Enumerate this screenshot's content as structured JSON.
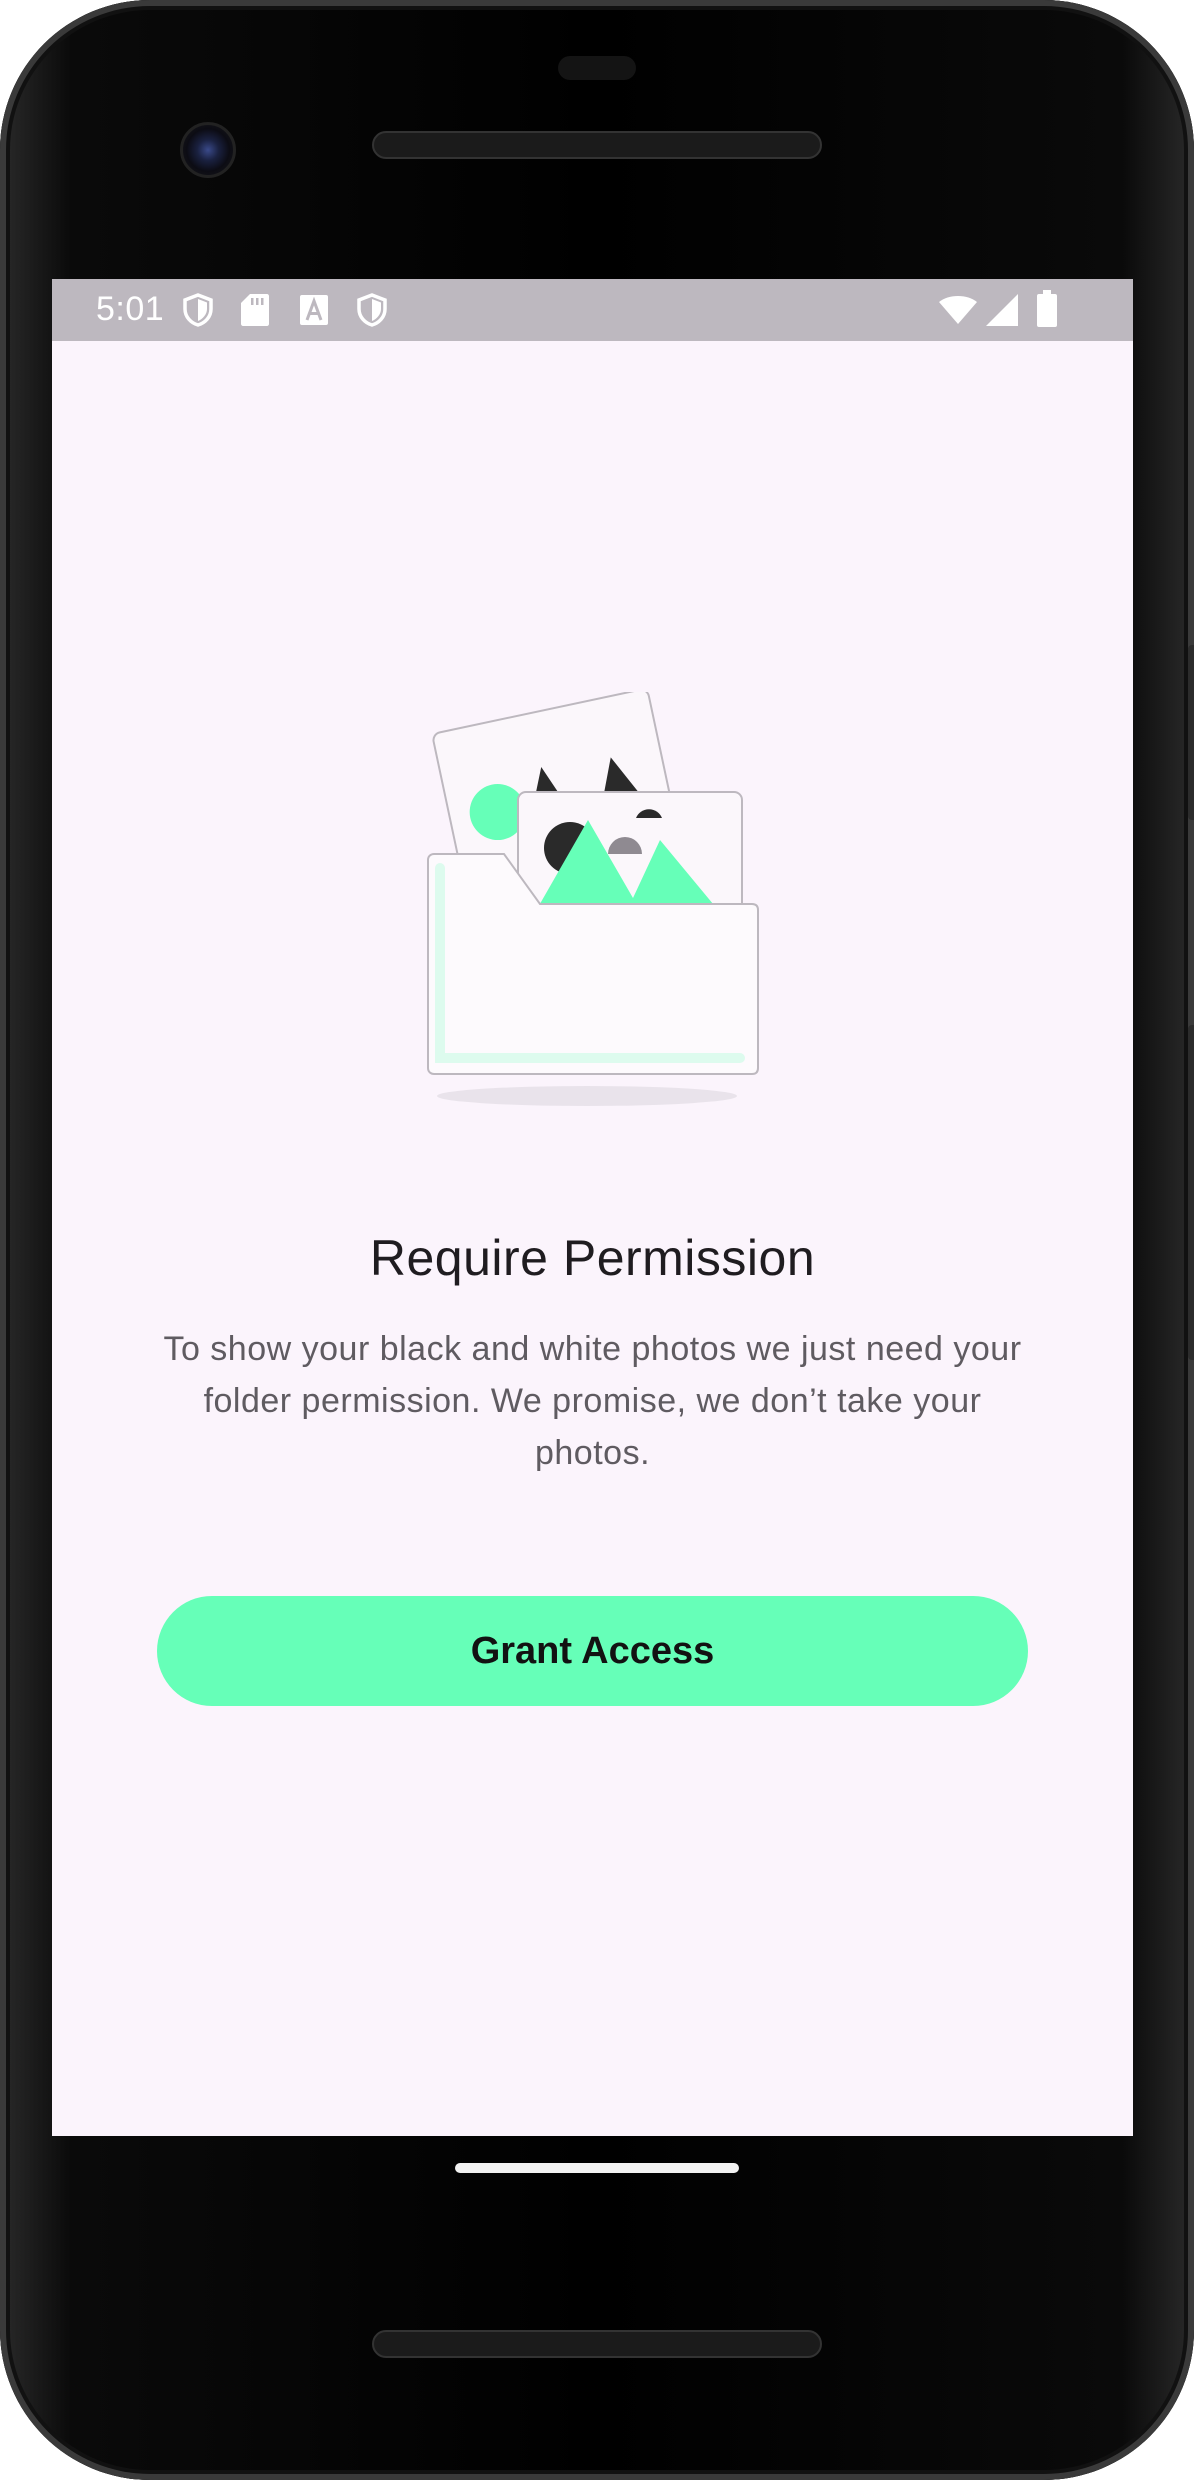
{
  "status_bar": {
    "time": "5:01",
    "left_icons": [
      "shield-icon",
      "sd-card-icon",
      "font-a-icon",
      "shield-icon"
    ],
    "right_icons": [
      "wifi-icon",
      "signal-icon",
      "battery-icon"
    ]
  },
  "permission_screen": {
    "illustration": "folder-photos-illustration",
    "title": "Require Permission",
    "description": "To show your black and white photos we just need your folder permission. We promise, we don’t take your photos.",
    "button_label": "Grant Access"
  },
  "colors": {
    "accent": "#66ffb8",
    "screen_background": "#fbf4fc",
    "status_bar": "#bdb8bf",
    "title_text": "#1f1c20",
    "body_text": "#5f5b61"
  }
}
